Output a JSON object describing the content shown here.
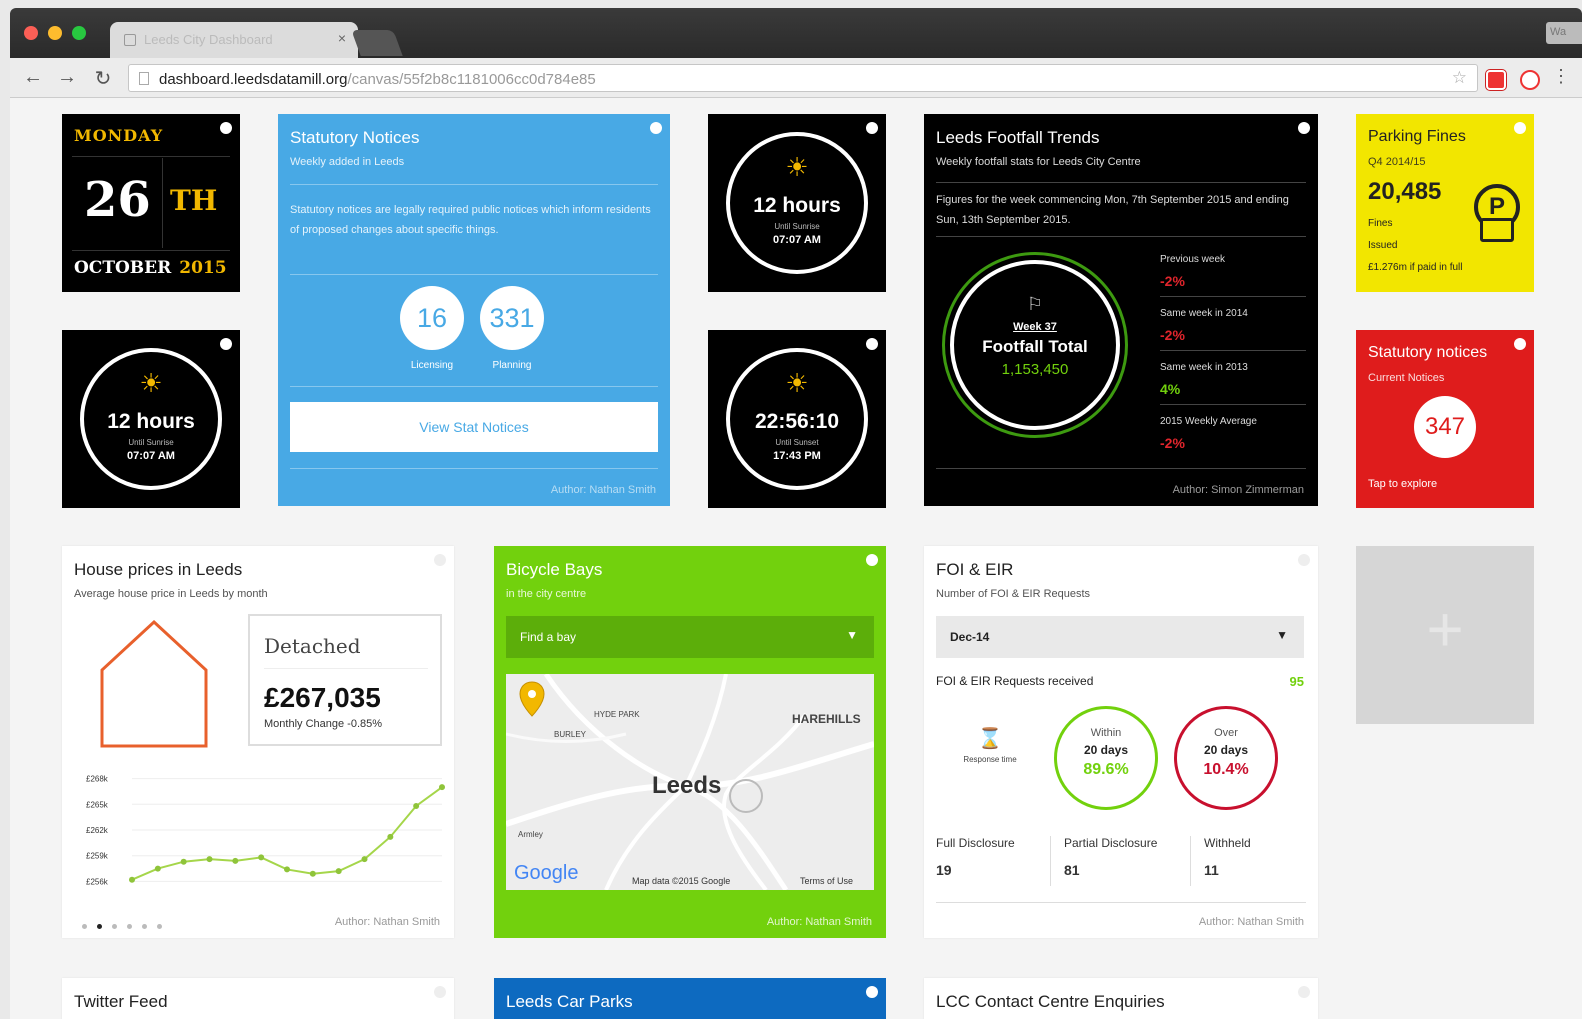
{
  "browser": {
    "tab_title": "Leeds City Dashboard",
    "tab_close": "×",
    "url_domain": "dashboard.leedsdatamill.org",
    "url_path": "/canvas/55f2b8c1181006cc0d784e85",
    "window_button": "Wa"
  },
  "date_tile": {
    "day": "MONDAY",
    "date": "26",
    "suffix": "TH",
    "month": "OCTOBER",
    "year": "2015"
  },
  "sunrise_tile_1": {
    "hours": "12 hours",
    "label": "Until Sunrise",
    "time": "07:07 AM"
  },
  "sunrise_tile_2": {
    "hours": "12 hours",
    "label": "Until Sunrise",
    "time": "07:07 AM"
  },
  "sunset_tile": {
    "clock": "22:56:10",
    "label": "Until Sunset",
    "time": "17:43 PM"
  },
  "statutory_notices": {
    "title": "Statutory Notices",
    "subtitle": "Weekly added in Leeds",
    "description": "Statutory notices are legally required public notices which inform residents of proposed changes about specific things.",
    "licensing_count": "16",
    "licensing_label": "Licensing",
    "planning_count": "331",
    "planning_label": "Planning",
    "button_label": "View Stat Notices",
    "author": "Author: Nathan Smith"
  },
  "footfall": {
    "title": "Leeds Footfall Trends",
    "subtitle": "Weekly footfall stats for Leeds City Centre",
    "description": "Figures for the week commencing Mon, 7th September 2015 and ending Sun, 13th September 2015.",
    "week": "Week 37",
    "total_label": "Footfall Total",
    "total_value": "1,153,450",
    "rows": [
      {
        "label": "Previous week",
        "value": "-2%",
        "color": "#e0252c"
      },
      {
        "label": "Same week in 2014",
        "value": "-2%",
        "color": "#e0252c"
      },
      {
        "label": "Same week in 2013",
        "value": "4%",
        "color": "#72d10d"
      },
      {
        "label": "2015 Weekly Average",
        "value": "-2%",
        "color": "#e0252c"
      }
    ],
    "author": "Author: Simon Zimmerman"
  },
  "parking_fines": {
    "title": "Parking Fines",
    "subtitle": "Q4 2014/15",
    "count": "20,485",
    "line1": "Fines",
    "line2": "Issued",
    "line3": "£1.276m if paid in full",
    "icon_letter": "P"
  },
  "statutory_notices_red": {
    "title": "Statutory notices",
    "subtitle": "Current Notices",
    "count": "347",
    "footer": "Tap to explore"
  },
  "house_prices": {
    "title": "House prices in Leeds",
    "subtitle": "Average house price in Leeds by month",
    "type": "Detached",
    "price": "£267,035",
    "change": "Monthly Change -0.85%",
    "author": "Author: Nathan Smith",
    "chart_data": {
      "type": "line",
      "y_ticks": [
        "£268k",
        "£265k",
        "£262k",
        "£259k",
        "£256k"
      ],
      "ylim": [
        255,
        269
      ],
      "values": [
        256.2,
        257.5,
        258.3,
        258.6,
        258.4,
        258.8,
        257.4,
        256.9,
        257.2,
        258.6,
        261.2,
        264.8,
        267.0
      ],
      "color": "#a5d64a"
    }
  },
  "bicycle_bays": {
    "title": "Bicycle Bays",
    "subtitle": "in the city centre",
    "dropdown": "Find a bay",
    "map_city": "Leeds",
    "map_place_1": "HYDE PARK",
    "map_place_2": "HAREHILLS",
    "map_place_3": "BURLEY",
    "map_place_4": "Armley",
    "map_logo": "Google",
    "map_credits": "Map data ©2015 Google",
    "map_terms": "Terms of Use",
    "author": "Author: Nathan Smith"
  },
  "foi": {
    "title": "FOI & EIR",
    "subtitle": "Number of FOI & EIR Requests",
    "dropdown": "Dec-14",
    "received_label": "FOI & EIR Requests received",
    "received_value": "95",
    "response_label": "Response time",
    "within_label": "Within",
    "within_days": "20 days",
    "within_pct": "89.6%",
    "over_label": "Over",
    "over_days": "20 days",
    "over_pct": "10.4%",
    "full_label": "Full Disclosure",
    "full_value": "19",
    "partial_label": "Partial Disclosure",
    "partial_value": "81",
    "withheld_label": "Withheld",
    "withheld_value": "11",
    "author": "Author: Nathan Smith"
  },
  "add_tile": {
    "symbol": "+"
  },
  "twitter": {
    "title": "Twitter Feed"
  },
  "car_parks": {
    "title": "Leeds Car Parks"
  },
  "contact_centre": {
    "title": "LCC Contact Centre Enquiries"
  }
}
